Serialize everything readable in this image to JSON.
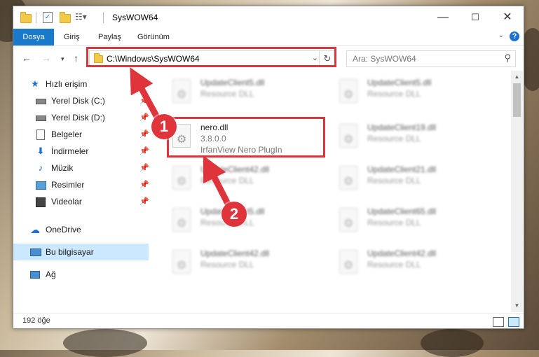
{
  "window": {
    "title": "SysWOW64"
  },
  "ribbon": {
    "tabs": [
      "Dosya",
      "Giriş",
      "Paylaş",
      "Görünüm"
    ],
    "help": "?"
  },
  "address": {
    "path": "C:\\Windows\\SysWOW64",
    "search_placeholder": "Ara: SysWOW64"
  },
  "nav": {
    "items": [
      {
        "label": "Hızlı erişim",
        "icon": "star-icon"
      },
      {
        "label": "Yerel Disk (C:)",
        "icon": "drive-icon",
        "pinned": true
      },
      {
        "label": "Yerel Disk (D:)",
        "icon": "drive-icon",
        "pinned": true
      },
      {
        "label": "Belgeler",
        "icon": "documents-icon",
        "pinned": true
      },
      {
        "label": "İndirmeler",
        "icon": "download-icon",
        "pinned": true
      },
      {
        "label": "Müzik",
        "icon": "music-icon",
        "pinned": true
      },
      {
        "label": "Resimler",
        "icon": "pictures-icon",
        "pinned": true
      },
      {
        "label": "Videolar",
        "icon": "videos-icon",
        "pinned": true
      },
      {
        "label": "OneDrive",
        "icon": "cloud-icon"
      },
      {
        "label": "Bu bilgisayar",
        "icon": "computer-icon",
        "selected": true
      },
      {
        "label": "Ağ",
        "icon": "network-icon"
      }
    ]
  },
  "files": {
    "highlighted": {
      "name": "nero.dll",
      "version": "3.8.0.0",
      "description": "IrfanView Nero PlugIn"
    },
    "left": [
      {
        "name": "UpdateClient5.dll",
        "description": "Resource DLL"
      },
      {
        "name": "UpdateClient42.dll",
        "description": "Resource DLL"
      },
      {
        "name": "UpdateClient5.dll",
        "description": "Resource DLL"
      },
      {
        "name": "UpdateClient42.dll",
        "description": "Resource DLL"
      }
    ],
    "right": [
      {
        "name": "UpdateClient5.dll",
        "description": "Resource DLL"
      },
      {
        "name": "UpdateClient19.dll",
        "description": "Resource DLL"
      },
      {
        "name": "UpdateClient21.dll",
        "description": "Resource DLL"
      },
      {
        "name": "UpdateClient65.dll",
        "description": "Resource DLL"
      },
      {
        "name": "UpdateClient42.dll",
        "description": "Resource DLL"
      }
    ]
  },
  "status": {
    "count": "192 öğe"
  },
  "annotations": {
    "step1": "1",
    "step2": "2",
    "color": "#e0343c"
  }
}
